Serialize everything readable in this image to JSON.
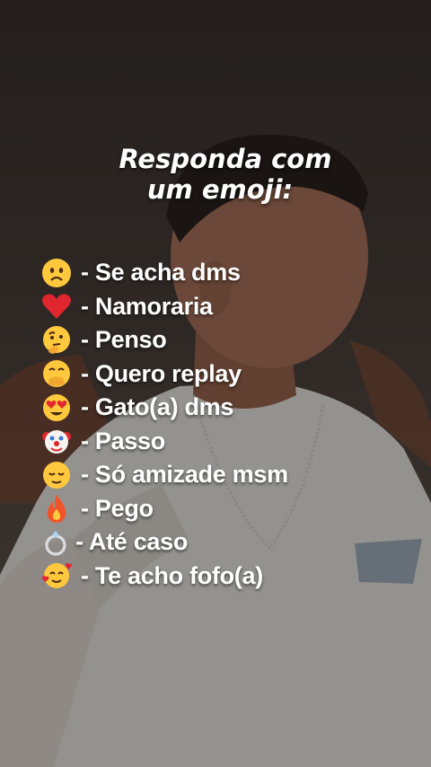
{
  "title": {
    "line1": "Responda com",
    "line2": "um emoji:"
  },
  "items": [
    {
      "icon": "worried-face-icon",
      "text": "- Se acha dms"
    },
    {
      "icon": "red-heart-icon",
      "text": "- Namoraria"
    },
    {
      "icon": "thinking-face-icon",
      "text": "- Penso"
    },
    {
      "icon": "face-with-hand-over-mouth-icon",
      "text": "- Quero replay"
    },
    {
      "icon": "heart-eyes-face-icon",
      "text": "- Gato(a) dms"
    },
    {
      "icon": "clown-face-icon",
      "text": "- Passo"
    },
    {
      "icon": "relieved-face-icon",
      "text": "- Só amizade msm"
    },
    {
      "icon": "fire-icon",
      "text": "- Pego"
    },
    {
      "icon": "ring-icon",
      "text": "- Até caso"
    },
    {
      "icon": "smiling-face-with-hearts-icon",
      "text": "- Te acho fofo(a)"
    }
  ]
}
